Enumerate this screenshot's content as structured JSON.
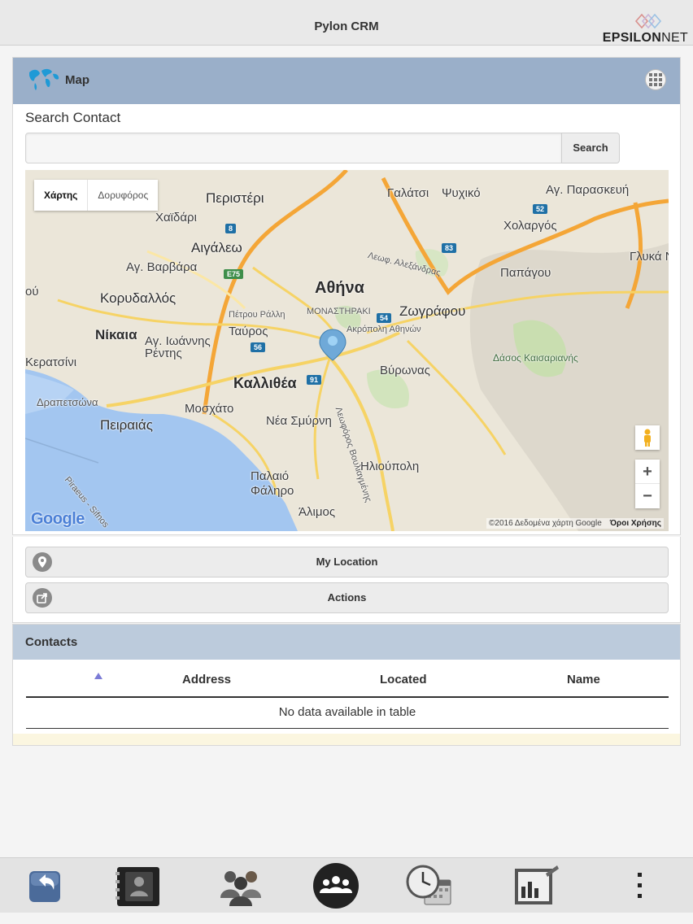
{
  "app": {
    "title": "Pylon CRM",
    "brand_main": "EPSILON",
    "brand_tail": "NET"
  },
  "map_panel": {
    "title": "Map",
    "search": {
      "label": "Search Contact",
      "value": "",
      "placeholder": "",
      "button": "Search"
    },
    "map": {
      "type_tabs": [
        "Χάρτης",
        "Δορυφόρος"
      ],
      "active_tab": "Χάρτης",
      "google_mark": "Google",
      "attribution": "©2016 Δεδομένα χάρτη Google",
      "terms": "Όροι Χρήσης",
      "labels": {
        "peristeri": "Περιστέρι",
        "galatsi": "Γαλάτσι",
        "psychiko": "Ψυχικό",
        "ag_paraskevi": "Αγ. Παρασκευή",
        "chaidari": "Χαϊδάρι",
        "cholargos": "Χολαργός",
        "aigaleo": "Αιγάλεω",
        "ag_varvara": "Αγ. Βαρβάρα",
        "glyka_nera": "Γλυκά Ν",
        "papagou": "Παπάγου",
        "korydallos": "Κορυδαλλός",
        "athina": "Αθήνα",
        "petrou_ralli": "Πέτρου Ράλλη",
        "monastiraki": "ΜΟΝΑΣΤΗΡΑΚΙ",
        "zografou": "Ζωγράφου",
        "nikaia": "Νίκαια",
        "tavros": "Ταύρος",
        "akropoli": "Ακρόπολη Αθηνών",
        "ag_ioannis": "Αγ. Ιωάννης Ρέντης",
        "keratsini": "Κερατσίνι",
        "dasos": "Δάσος Καισαριανής",
        "kallithea": "Καλλιθέα",
        "vyronas": "Βύρωνας",
        "drapetsona": "Δραπετσώνα",
        "moschato": "Μοσχάτο",
        "peiraias": "Πειραιάς",
        "nea_smyrni": "Νέα Σμύρνη",
        "ilioupoli": "Ηλιούπολη",
        "palaio_faliro": "Παλαιό Φάληρο",
        "alimos": "Άλιμος",
        "leof_alexandras": "Λεωφ. Αλεξάνδρας",
        "leof_vouliagmenis": "Λεωφόρος Βουλιαγμένης",
        "piraeus_sifnos": "Piraeus - Sifnos",
        "partial_left": "ού"
      },
      "shields": {
        "s8": "8",
        "s83": "83",
        "s52": "52",
        "s54": "54",
        "s56": "56",
        "s91": "91",
        "sE75": "E75"
      }
    }
  },
  "actions": {
    "my_location": "My Location",
    "actions": "Actions"
  },
  "contacts": {
    "title": "Contacts",
    "columns": [
      "Address",
      "Located",
      "Name"
    ],
    "sorted_column": 0,
    "empty_message": "No data available in table"
  },
  "bottom_nav": [
    "back-icon",
    "address-book-icon",
    "contacts-group-icon",
    "groups-icon",
    "schedule-icon",
    "report-icon",
    "more-icon"
  ],
  "colors": {
    "panel_header": "#9aafc9",
    "contacts_header": "#bccbdc",
    "water": "#a3c6f0",
    "highway": "#f4a637",
    "main_road": "#f6d365"
  }
}
